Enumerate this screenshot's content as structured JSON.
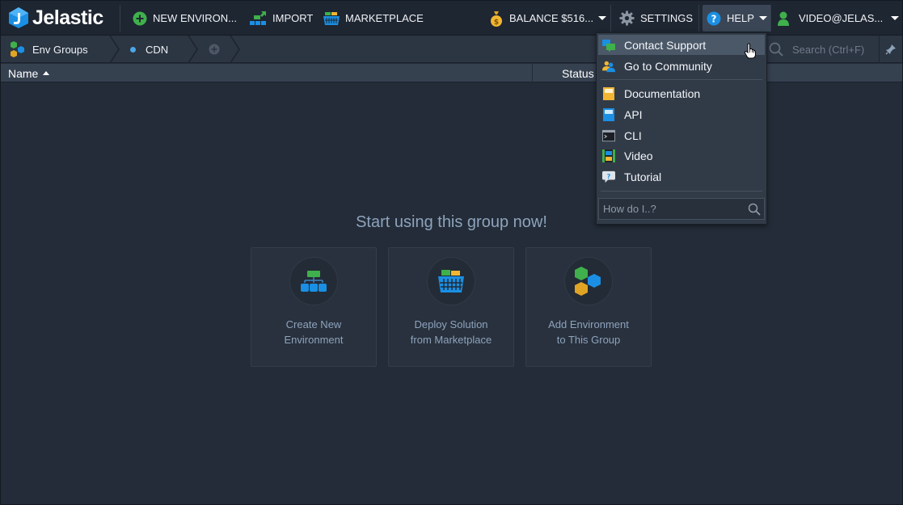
{
  "header": {
    "brand": "Jelastic",
    "new_env_label": "NEW ENVIRON...",
    "import_label": "IMPORT",
    "marketplace_label": "MARKETPLACE",
    "balance_label": "BALANCE $516...",
    "settings_label": "SETTINGS",
    "help_label": "HELP",
    "user_label": "VIDEO@JELAS..."
  },
  "breadcrumb": {
    "env_groups": "Env Groups",
    "current_group": "CDN"
  },
  "search": {
    "placeholder": "Search (Ctrl+F)"
  },
  "table": {
    "columns": [
      "Name",
      "Status"
    ]
  },
  "empty_state": {
    "title": "Start using this group now!",
    "cards": [
      {
        "line1": "Create New",
        "line2": "Environment"
      },
      {
        "line1": "Deploy Solution",
        "line2": "from Marketplace"
      },
      {
        "line1": "Add Environment",
        "line2": "to This Group"
      }
    ]
  },
  "help_menu": {
    "items": [
      {
        "label": "Contact Support",
        "icon": "contact-support-icon"
      },
      {
        "label": "Go to Community",
        "icon": "community-icon"
      },
      {
        "label": "Documentation",
        "icon": "documentation-icon"
      },
      {
        "label": "API",
        "icon": "api-icon"
      },
      {
        "label": "CLI",
        "icon": "cli-icon"
      },
      {
        "label": "Video",
        "icon": "video-icon"
      },
      {
        "label": "Tutorial",
        "icon": "tutorial-icon"
      }
    ],
    "search_placeholder": "How do I..?"
  },
  "colors": {
    "background": "#232c38",
    "topbar": "#1e2632",
    "accent_blue": "#1a8fe3",
    "accent_green": "#3fb04b",
    "text_muted": "#8ea3bd"
  }
}
